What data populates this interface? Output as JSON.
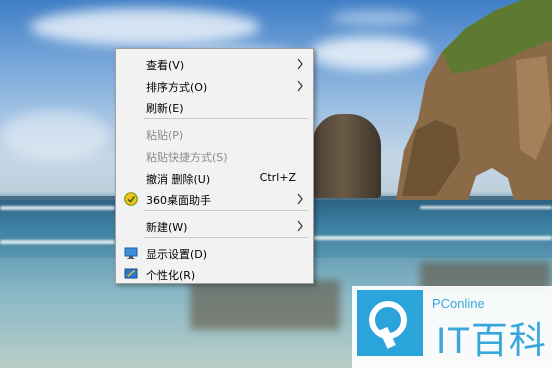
{
  "menu": {
    "items": [
      {
        "label": "查看(V)",
        "submenu": true
      },
      {
        "label": "排序方式(O)",
        "submenu": true
      },
      {
        "label": "刷新(E)"
      },
      {
        "label": "粘贴(P)",
        "disabled": true
      },
      {
        "label": "粘贴快捷方式(S)",
        "disabled": true
      },
      {
        "label": "撤消 删除(U)",
        "shortcut": "Ctrl+Z"
      },
      {
        "label": "360桌面助手",
        "submenu": true,
        "icon": "360-assistant-icon"
      },
      {
        "label": "新建(W)",
        "submenu": true
      },
      {
        "label": "显示设置(D)",
        "icon": "display-settings-icon"
      },
      {
        "label": "个性化(R)",
        "icon": "personalize-icon"
      }
    ]
  },
  "watermark": {
    "brand": "PConline",
    "title": "IT百科",
    "logo": "magnifier-logo-icon"
  },
  "colors": {
    "menu_background": "#f2f2f2",
    "disabled_text": "#8a8a8a",
    "watermark_blue": "#2ba4dc"
  }
}
